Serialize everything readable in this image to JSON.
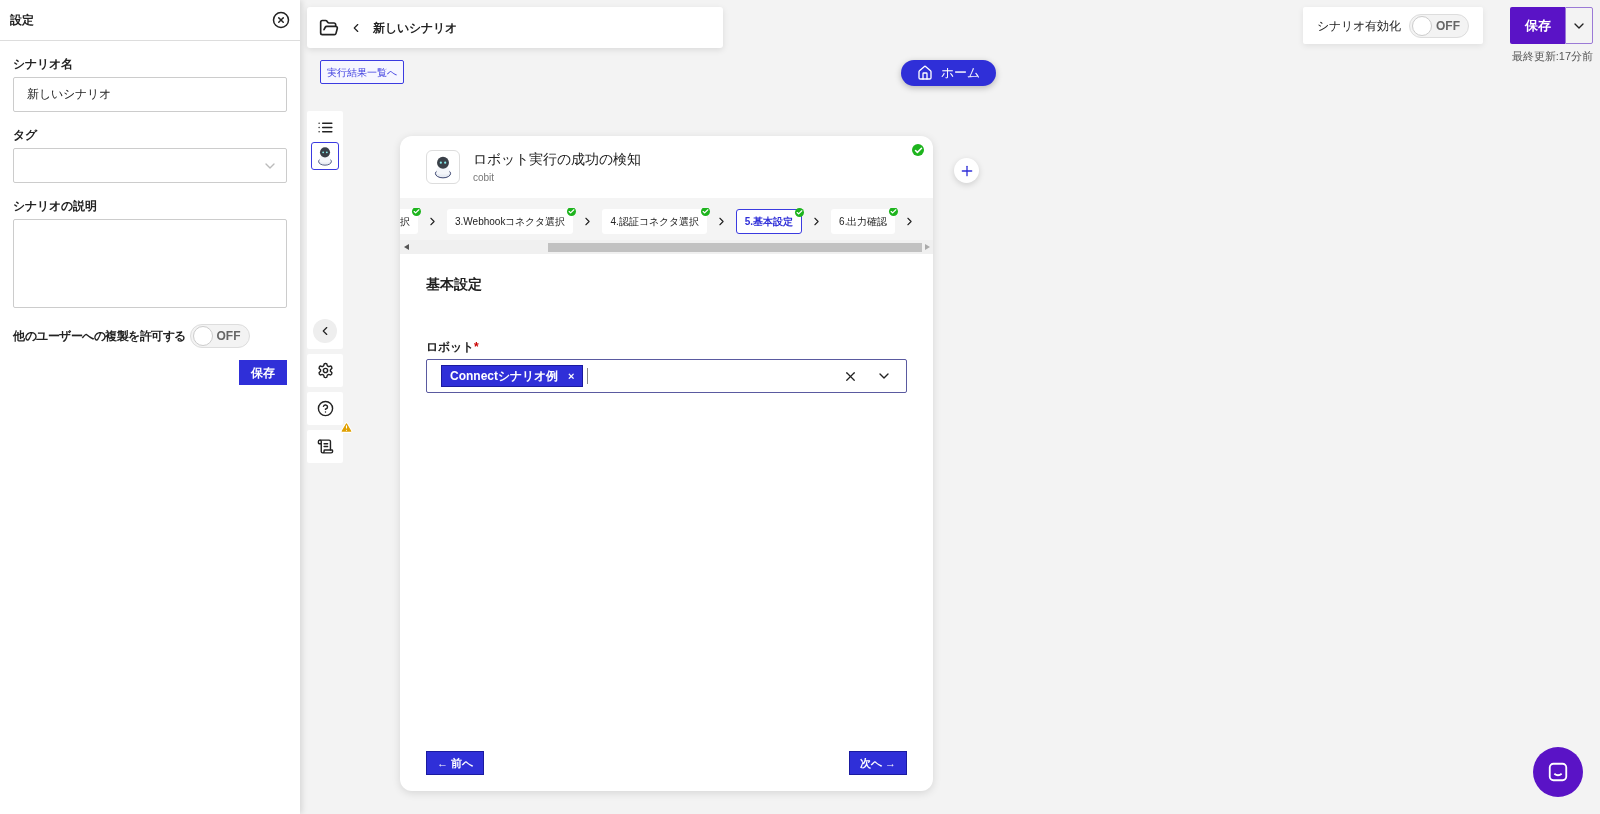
{
  "settings_panel": {
    "title": "設定",
    "fields": [
      {
        "kind": "text",
        "label": "シナリオ名",
        "value": "新しいシナリオ"
      },
      {
        "kind": "select",
        "label": "タグ"
      },
      {
        "kind": "textarea",
        "label": "シナリオの説明"
      }
    ],
    "copy_toggle": {
      "label": "他のユーザーへの複製を許可する",
      "on": false,
      "state_text": "OFF"
    },
    "save_button": "保存"
  },
  "top_bar": {
    "title": "新しいシナリオ"
  },
  "results_link": "実行結果一覧へ",
  "home_button": "ホーム",
  "enable_toggle": {
    "label": "シナリオ有効化",
    "on": false,
    "state_text": "OFF"
  },
  "save_button": "保存",
  "last_updated": "最終更新:17分前",
  "side_toolbar": {
    "robot_selected": true,
    "log_warning": true
  },
  "card": {
    "title": "ロボット実行の成功の検知",
    "subtitle": "cobit",
    "done": true,
    "steps": [
      {
        "label": "択",
        "selected": false,
        "done": true
      },
      {
        "label": "3.Webhookコネクタ選択",
        "selected": false,
        "done": true
      },
      {
        "label": "4.認証コネクタ選択",
        "selected": false,
        "done": true
      },
      {
        "label": "5.基本設定",
        "selected": true,
        "done": true
      },
      {
        "label": "6.出力確認",
        "selected": false,
        "done": true
      }
    ],
    "section_title": "基本設定",
    "robot_field": {
      "label": "ロボット",
      "required_mark": "*",
      "tags": [
        "Connectシナリオ例"
      ],
      "tag_remove": "×"
    },
    "prev_button": "← 前へ",
    "next_button": "次へ →"
  }
}
